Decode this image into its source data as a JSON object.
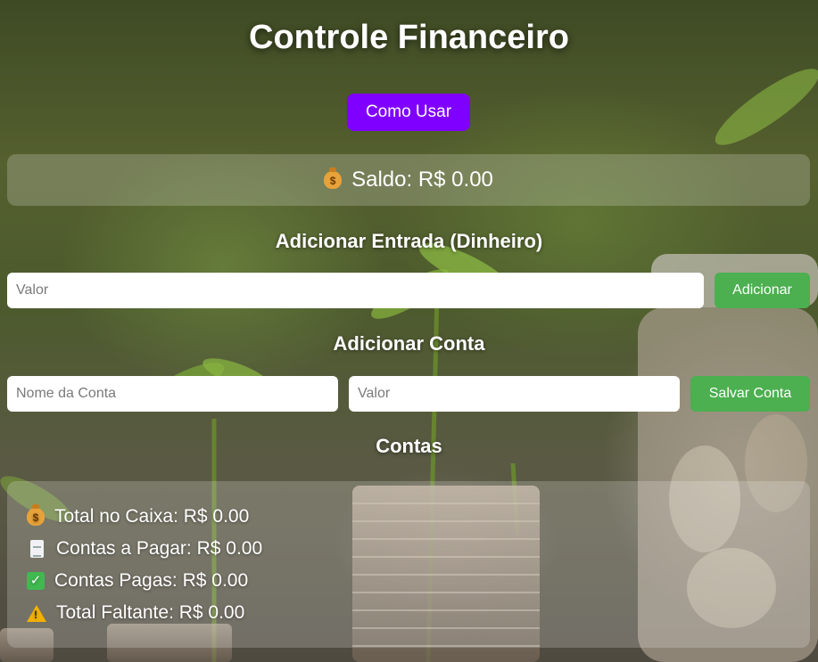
{
  "header": {
    "title": "Controle Financeiro",
    "how_to_label": "Como Usar"
  },
  "balance": {
    "icon": "money-bag-icon",
    "label": "Saldo: R$ 0.00"
  },
  "add_income": {
    "title": "Adicionar Entrada (Dinheiro)",
    "value_placeholder": "Valor",
    "add_label": "Adicionar"
  },
  "add_bill": {
    "title": "Adicionar Conta",
    "name_placeholder": "Nome da Conta",
    "value_placeholder": "Valor",
    "save_label": "Salvar Conta"
  },
  "bills": {
    "title": "Contas",
    "summary": [
      {
        "icon": "money-bag-icon",
        "text": "Total no Caixa: R$ 0.00"
      },
      {
        "icon": "document-icon",
        "text": "Contas a Pagar: R$ 0.00"
      },
      {
        "icon": "check-icon",
        "text": "Contas Pagas: R$ 0.00"
      },
      {
        "icon": "warning-icon",
        "text": "Total Faltante: R$ 0.00"
      }
    ]
  },
  "colors": {
    "primary_button": "#8000ff",
    "success_button": "#4caf50"
  }
}
